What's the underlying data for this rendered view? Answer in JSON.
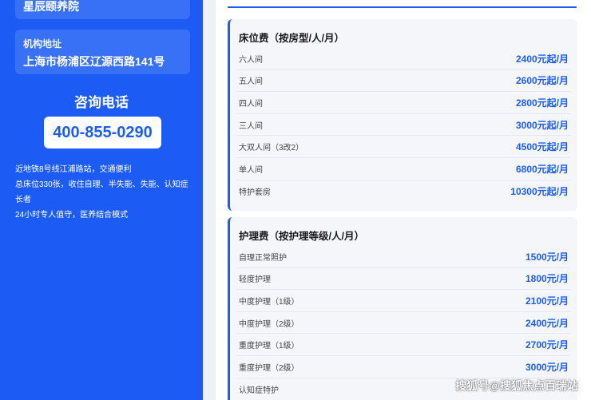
{
  "institution": {
    "name": "星辰颐养院",
    "address_label": "机构地址",
    "address": "上海市杨浦区辽源西路141号"
  },
  "hotline": {
    "title": "咨询电话",
    "number": "400-855-0290"
  },
  "features": [
    "近地铁8号线江浦路站，交通便利",
    "总床位330张，收住自理、半失能、失能、认知症长者",
    "24小时专人值守，医养结合模式"
  ],
  "bed_fees": {
    "title": "床位费（按房型/人/月）",
    "rows": [
      {
        "label": "六人间",
        "price": "2400元起/月"
      },
      {
        "label": "五人间",
        "price": "2600元起/月"
      },
      {
        "label": "四人间",
        "price": "2800元起/月"
      },
      {
        "label": "三人间",
        "price": "3000元起/月"
      },
      {
        "label": "大双人间（3改2）",
        "price": "4500元起/月"
      },
      {
        "label": "单人间",
        "price": "6800元起/月"
      },
      {
        "label": "特护套房",
        "price": "10300元起/月"
      }
    ]
  },
  "care_fees": {
    "title": "护理费（按护理等级/人/月）",
    "rows": [
      {
        "label": "自理正常照护",
        "price": "1500元/月"
      },
      {
        "label": "轻度护理",
        "price": "1800元/月"
      },
      {
        "label": "中度护理（1级）",
        "price": "2100元/月"
      },
      {
        "label": "中度护理（2级）",
        "price": "2400元/月"
      },
      {
        "label": "重度护理（1级）",
        "price": "2700元/月"
      },
      {
        "label": "重度护理（2级）",
        "price": "3000元/月"
      },
      {
        "label": "认知症特护",
        "price": ""
      }
    ]
  },
  "watermark": "搜狐号@搜狐焦点百瑞站",
  "colors": {
    "accent": "#1c5cf5",
    "card_bg": "#f4f6fa"
  }
}
